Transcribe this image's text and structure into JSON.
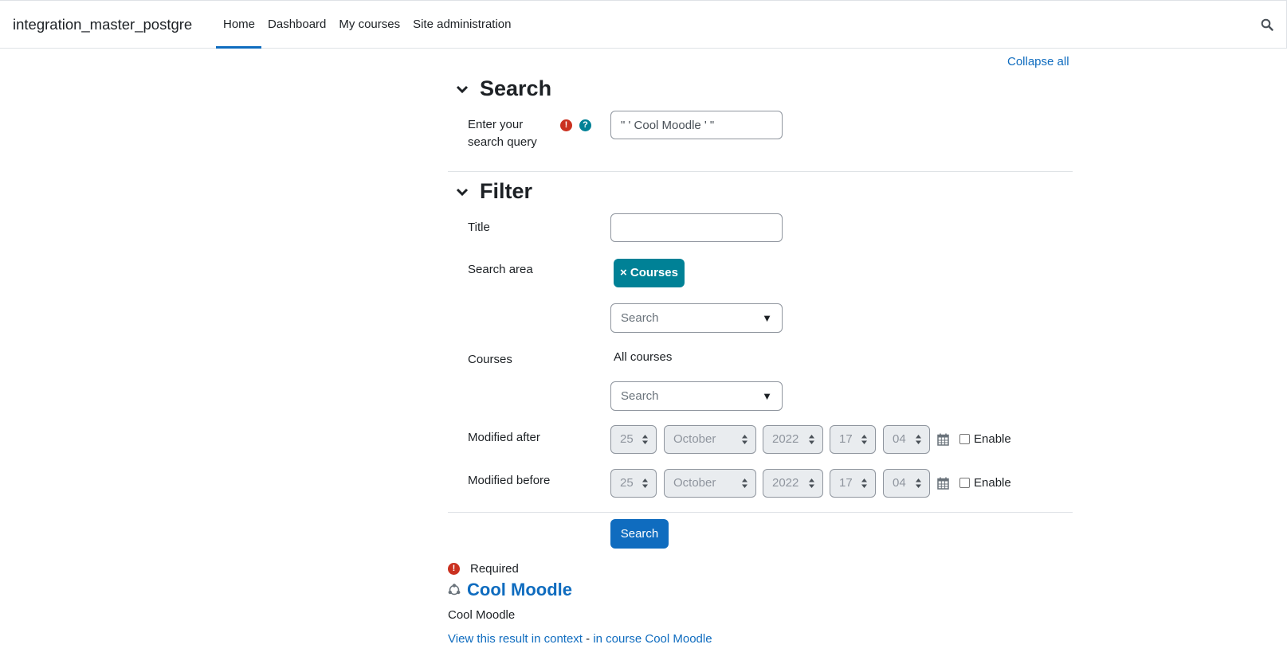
{
  "site": {
    "name": "integration_master_postgre"
  },
  "nav": {
    "items": [
      {
        "label": "Home",
        "active": true
      },
      {
        "label": "Dashboard",
        "active": false
      },
      {
        "label": "My courses",
        "active": false
      },
      {
        "label": "Site administration",
        "active": false
      }
    ],
    "search_icon": "search-icon"
  },
  "form": {
    "collapse_all": "Collapse all",
    "search_section": {
      "title": "Search",
      "query_label": "Enter your search query",
      "query_value": "\" ' Cool Moodle ' \""
    },
    "filter_section": {
      "title": "Filter",
      "title_label": "Title",
      "title_value": "",
      "search_area_label": "Search area",
      "search_area_tag": "× Courses",
      "search_area_placeholder": "Search",
      "courses_label": "Courses",
      "courses_value": "All courses",
      "courses_placeholder": "Search",
      "modified_after": {
        "label": "Modified after",
        "day": "25",
        "month": "October",
        "year": "2022",
        "hour": "17",
        "minute": "04",
        "enable_label": "Enable",
        "enabled": false
      },
      "modified_before": {
        "label": "Modified before",
        "day": "25",
        "month": "October",
        "year": "2022",
        "hour": "17",
        "minute": "04",
        "enable_label": "Enable",
        "enabled": false
      }
    },
    "submit_label": "Search",
    "required_legend": "Required"
  },
  "results": [
    {
      "title": "Cool Moodle",
      "description": "Cool Moodle",
      "context_link": "View this result in context",
      "separator": " - ",
      "course_link": "in course Cool Moodle"
    }
  ],
  "colors": {
    "primary": "#0f6cbf",
    "info": "#008196",
    "danger": "#ca3120"
  }
}
